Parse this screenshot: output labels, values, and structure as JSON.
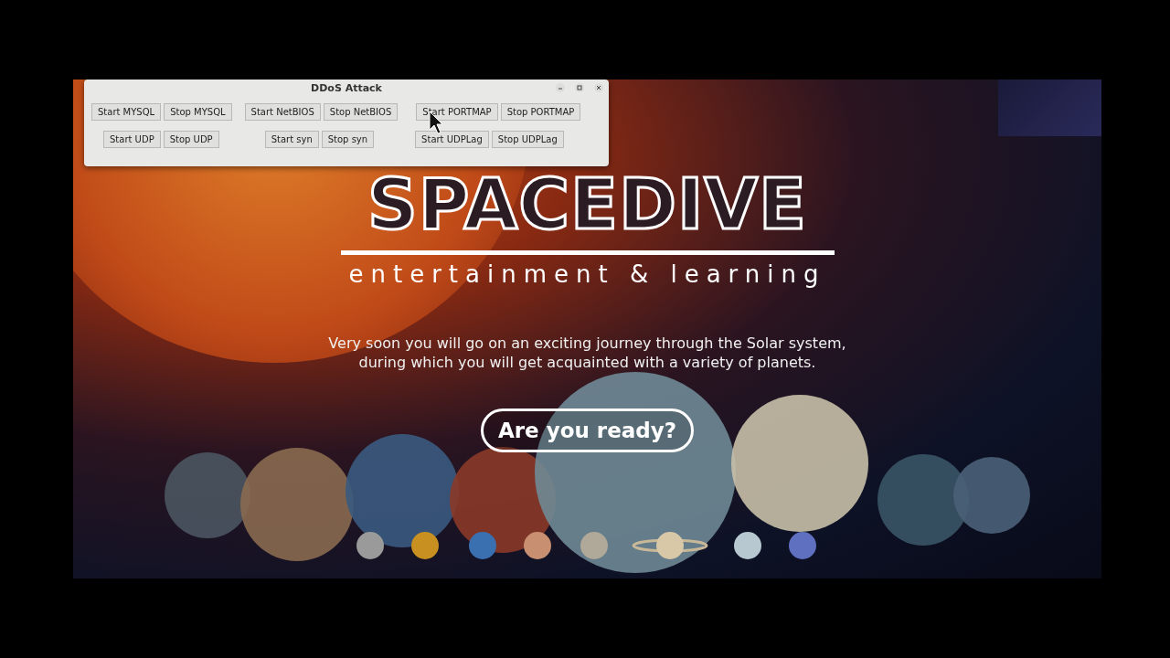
{
  "app_window": {
    "title": "DDoS Attack",
    "button_rows": [
      [
        "Start MYSQL",
        "Stop MYSQL",
        "Start NetBIOS",
        "Stop NetBIOS",
        "Start PORTMAP",
        "Stop PORTMAP"
      ],
      [
        "Start UDP",
        "Stop UDP",
        "Start syn",
        "Stop syn",
        "Start UDPLag",
        "Stop UDPLag"
      ]
    ]
  },
  "webpage": {
    "logo": "SPACEDIVE",
    "tagline": "entertainment & learning",
    "description": "Very soon you will go on an exciting journey through the Solar system, during which you will get acquainted with a variety of planets.",
    "cta": "Are you ready?"
  }
}
